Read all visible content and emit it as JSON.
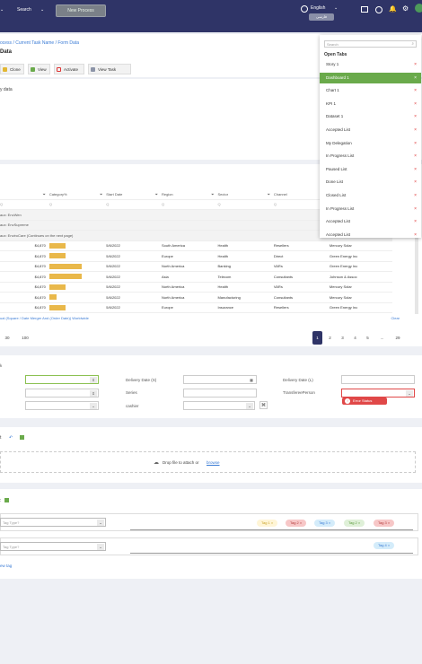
{
  "topbar": {
    "search_label": "Search",
    "new_process_label": "New Process",
    "language": "English",
    "language_alt": "فارسی"
  },
  "page": {
    "breadcrumb": "ocess / Current Task Name / Form Data",
    "title": "Data",
    "toolbar": {
      "clone": "Clone",
      "view": "View",
      "activate": "Activate",
      "view_task": "View Task"
    },
    "side_text": "y data"
  },
  "grid": {
    "headers": [
      "",
      "Category%",
      "Start Date",
      "Region",
      "Sector",
      "Channel",
      "Name"
    ],
    "filter_placeholder": "Q",
    "groups": [
      "aux: EnvWen",
      "aux: EnvSupreme",
      "aux: EnviroCare (Continues on the next page)"
    ],
    "rows": [
      {
        "amount": "$4,870",
        "pct": 0.45,
        "date": "5/6/2022",
        "region": "South America",
        "sector": "Health",
        "channel": "Resellers",
        "name": "Mercury Solar"
      },
      {
        "amount": "$4,870",
        "pct": 0.45,
        "date": "5/6/2022",
        "region": "Europe",
        "sector": "Health",
        "channel": "Direct",
        "name": "Green Energy Inc"
      },
      {
        "amount": "$4,870",
        "pct": 0.9,
        "date": "5/6/2022",
        "region": "North America",
        "sector": "Banking",
        "channel": "VARs",
        "name": "Green Energy Inc"
      },
      {
        "amount": "$4,870",
        "pct": 0.9,
        "date": "5/6/2022",
        "region": "Asia",
        "sector": "Telecom",
        "channel": "Consultants",
        "name": "Johnson & Assoc"
      },
      {
        "amount": "$4,870",
        "pct": 0.45,
        "date": "5/6/2022",
        "region": "North America",
        "sector": "Health",
        "channel": "VARs",
        "name": "Mercury Solar"
      },
      {
        "amount": "$4,870",
        "pct": 0.2,
        "date": "5/6/2022",
        "region": "North America",
        "sector": "Manufacturing",
        "channel": "Consultants",
        "name": "Mercury Solar"
      },
      {
        "amount": "$4,870",
        "pct": 0.45,
        "date": "5/6/2022",
        "region": "Europe",
        "sector": "Insurance",
        "channel": "Resellers",
        "name": "Green Energy Inc"
      }
    ],
    "footer_text": "ual (Square / Date Merger And (Order Date)) Worldwide",
    "clear_label": "Clear"
  },
  "pager": {
    "sizes": [
      "30",
      "100"
    ],
    "pages": [
      "1",
      "2",
      "3",
      "4",
      "5",
      "...",
      "29"
    ]
  },
  "form": {
    "delivery_date_s": "Delivery Date (S)",
    "delivery_date_l": "Delivery Date (L)",
    "series": "Series",
    "transferee_person": "TransfereePerson",
    "cashier": "cashier",
    "error_status": "Error Status",
    "section_short": "k"
  },
  "attach": {
    "drop_text": "Drop file to attach or",
    "browse": "browse"
  },
  "tags": {
    "type_placeholder": "Tag Type?",
    "row1": [
      "Tag 1",
      "Tag 2",
      "Tag 3",
      "Tag 2",
      "Tag 3"
    ],
    "row2": [
      "Tag 4"
    ],
    "new_tag": "ew tag"
  },
  "open_tabs": {
    "search_placeholder": "Search",
    "title": "Open Tabs",
    "items": [
      "Story 1",
      "Dashboard 1",
      "Chart 1",
      "KPI 1",
      "Dataset 1",
      "Accepted List",
      "My Delegation",
      "In Progress List",
      "Paused List",
      "Done List",
      "Closed List",
      "In Progress List",
      "Accepted List",
      "Accepted List"
    ]
  },
  "colors": {
    "topbar": "#2f3467",
    "active_tab": "#6aaa4b",
    "accent": "#3a7bd5",
    "error": "#e04848",
    "bar": "#e9b84a"
  }
}
